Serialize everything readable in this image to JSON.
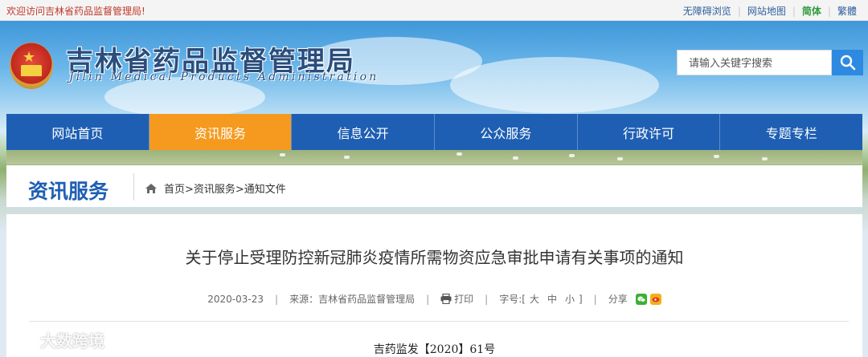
{
  "topbar": {
    "welcome": "欢迎访问吉林省药品监督管理局!",
    "links": [
      "无障碍浏览",
      "网站地图",
      "简体",
      "繁體"
    ]
  },
  "header": {
    "title": "吉林省药品监督管理局",
    "subtitle": "Jilin Medical Products Administration",
    "search_placeholder": "请输入关键字搜索"
  },
  "nav": {
    "items": [
      "网站首页",
      "资讯服务",
      "信息公开",
      "公众服务",
      "行政许可",
      "专题专栏"
    ],
    "active": "资讯服务"
  },
  "section": {
    "title": "资讯服务",
    "breadcrumb": "首页>资讯服务>通知文件"
  },
  "article": {
    "title": "关于停止受理防控新冠肺炎疫情所需物资应急审批申请有关事项的通知",
    "date": "2020-03-23",
    "source": "来源：吉林省药品监督管理局",
    "print_label": "打印",
    "fontsize_label": "字号:[",
    "font_large": "大",
    "font_medium": "中",
    "font_small": "小",
    "fontsize_close": "]",
    "share_label": "分享",
    "doc_number": "吉药监发【2020】61号"
  },
  "watermark": "大数跨境",
  "colors": {
    "nav_bg": "#1e5fb3",
    "nav_active": "#f59a1e",
    "search_button": "#2e8ae0"
  }
}
